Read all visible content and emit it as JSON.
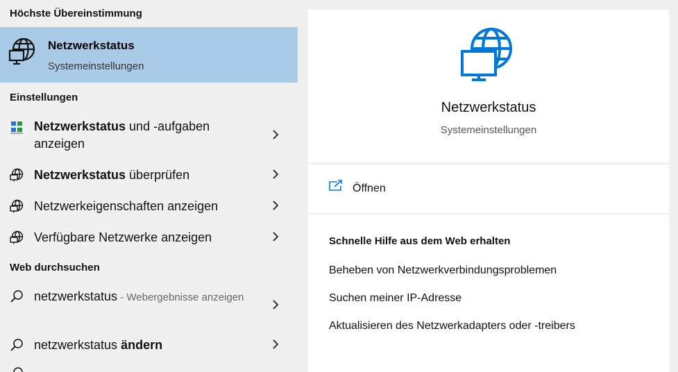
{
  "left": {
    "best_match_header": "Höchste Übereinstimmung",
    "best_match": {
      "title": "Netzwerkstatus",
      "subtitle": "Systemeinstellungen",
      "icon": "globe-monitor-icon"
    },
    "settings_header": "Einstellungen",
    "settings": [
      {
        "bold": "Netzwerkstatus",
        "rest": " und -aufgaben anzeigen",
        "icon": "network-tasks-icon"
      },
      {
        "bold": "Netzwerkstatus",
        "rest": " überprüfen",
        "icon": "globe-monitor-icon"
      },
      {
        "bold": "",
        "rest": "Netzwerkeigenschaften anzeigen",
        "icon": "globe-monitor-icon"
      },
      {
        "bold": "",
        "rest": "Verfügbare Netzwerke anzeigen",
        "icon": "globe-monitor-icon"
      }
    ],
    "web_header": "Web durchsuchen",
    "web": [
      {
        "text": "netzwerkstatus",
        "muted": " - Webergebnisse anzeigen",
        "icon": "search-icon"
      },
      {
        "text": "netzwerkstatus ",
        "bold": "ändern",
        "icon": "search-icon"
      }
    ]
  },
  "right": {
    "app_name": "Netzwerkstatus",
    "app_category": "Systemeinstellungen",
    "open_label": "Öffnen",
    "help_title": "Schnelle Hilfe aus dem Web erhalten",
    "help_links": [
      "Beheben von Netzwerkverbindungsproblemen",
      "Suchen meiner IP-Adresse",
      "Aktualisieren des Netzwerkadapters oder -treibers"
    ]
  },
  "colors": {
    "selected_bg": "#a9cbe8",
    "accent": "#0078d7",
    "left_bg": "#f0f0f0"
  }
}
